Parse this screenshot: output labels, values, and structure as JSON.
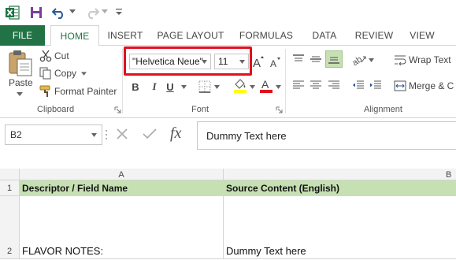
{
  "qat": {
    "icons": [
      "excel-logo-icon",
      "save-icon",
      "undo-icon",
      "redo-icon",
      "customize-qat-icon"
    ]
  },
  "tabs": [
    {
      "label": "FILE"
    },
    {
      "label": "HOME",
      "active": true
    },
    {
      "label": "INSERT"
    },
    {
      "label": "PAGE LAYOUT"
    },
    {
      "label": "FORMULAS"
    },
    {
      "label": "DATA"
    },
    {
      "label": "REVIEW"
    },
    {
      "label": "VIEW"
    }
  ],
  "ribbon": {
    "clipboard": {
      "paste_label": "Paste",
      "cut_label": "Cut",
      "copy_label": "Copy",
      "format_painter_label": "Format Painter",
      "group_label": "Clipboard"
    },
    "font": {
      "font_name": "\"Helvetica Neue\"",
      "font_size": "11",
      "group_label": "Font",
      "bold": "B",
      "italic": "I",
      "underline": "U",
      "highlight_color": "#ffff00",
      "font_color": "#e0101e"
    },
    "alignment": {
      "wrap_text_label": "Wrap Text",
      "merge_label": "Merge & C",
      "group_label": "Alignment"
    }
  },
  "formula_bar": {
    "name_box": "B2",
    "fx": "fx",
    "content": "Dummy Text here"
  },
  "grid": {
    "columns": [
      "A",
      "B"
    ],
    "rows": [
      {
        "num": "1",
        "a": "Descriptor / Field Name",
        "b": "Source Content (English)"
      },
      {
        "num": "2",
        "a": "FLAVOR NOTES:",
        "b": "Dummy Text here"
      }
    ]
  },
  "colors": {
    "brand": "#217346",
    "header_fill": "#c6e0b4",
    "highlight_border": "#e0101e"
  }
}
